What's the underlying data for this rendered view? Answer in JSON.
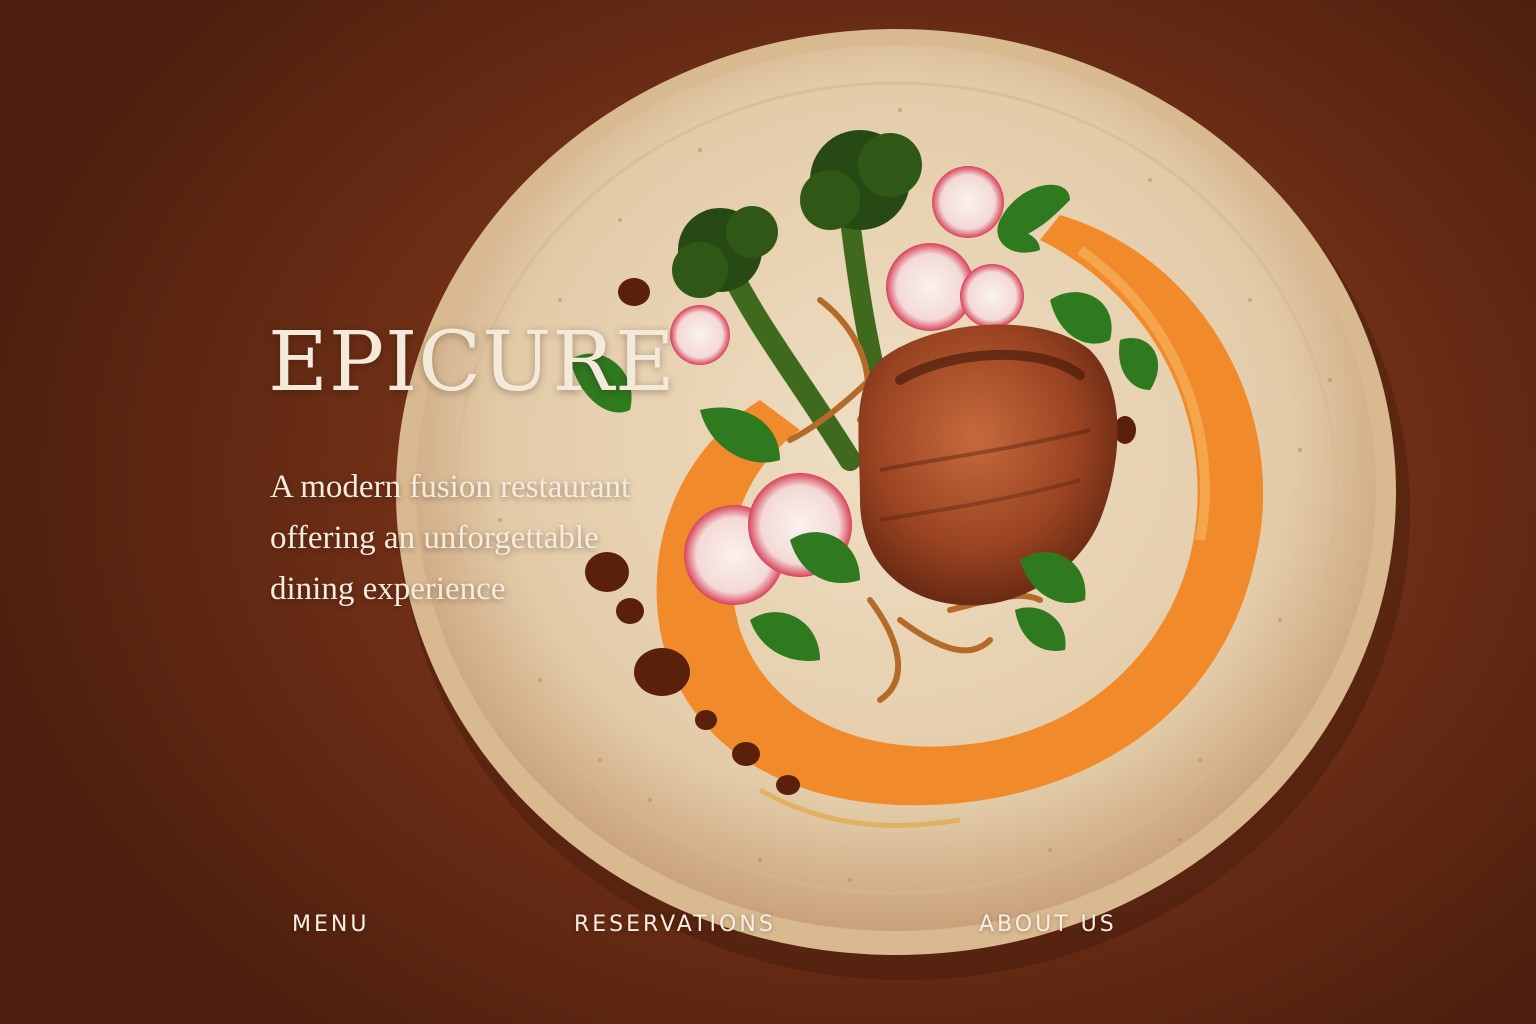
{
  "brand": {
    "name": "EPICURE"
  },
  "hero": {
    "tagline_lines": [
      "A modern fusion restaurant",
      "offering an unforgettable",
      "dining experience"
    ],
    "image": "plated-dish-with-seared-fish-broccolini-radish-carrot-puree"
  },
  "nav": {
    "items": [
      {
        "label": "MENU"
      },
      {
        "label": "RESERVATIONS"
      },
      {
        "label": "ABOUT US"
      }
    ]
  },
  "colors": {
    "background": "#6e2e16",
    "plate": "#e9d6b9",
    "puree": "#f08a2a",
    "text": "#f3eadc"
  }
}
